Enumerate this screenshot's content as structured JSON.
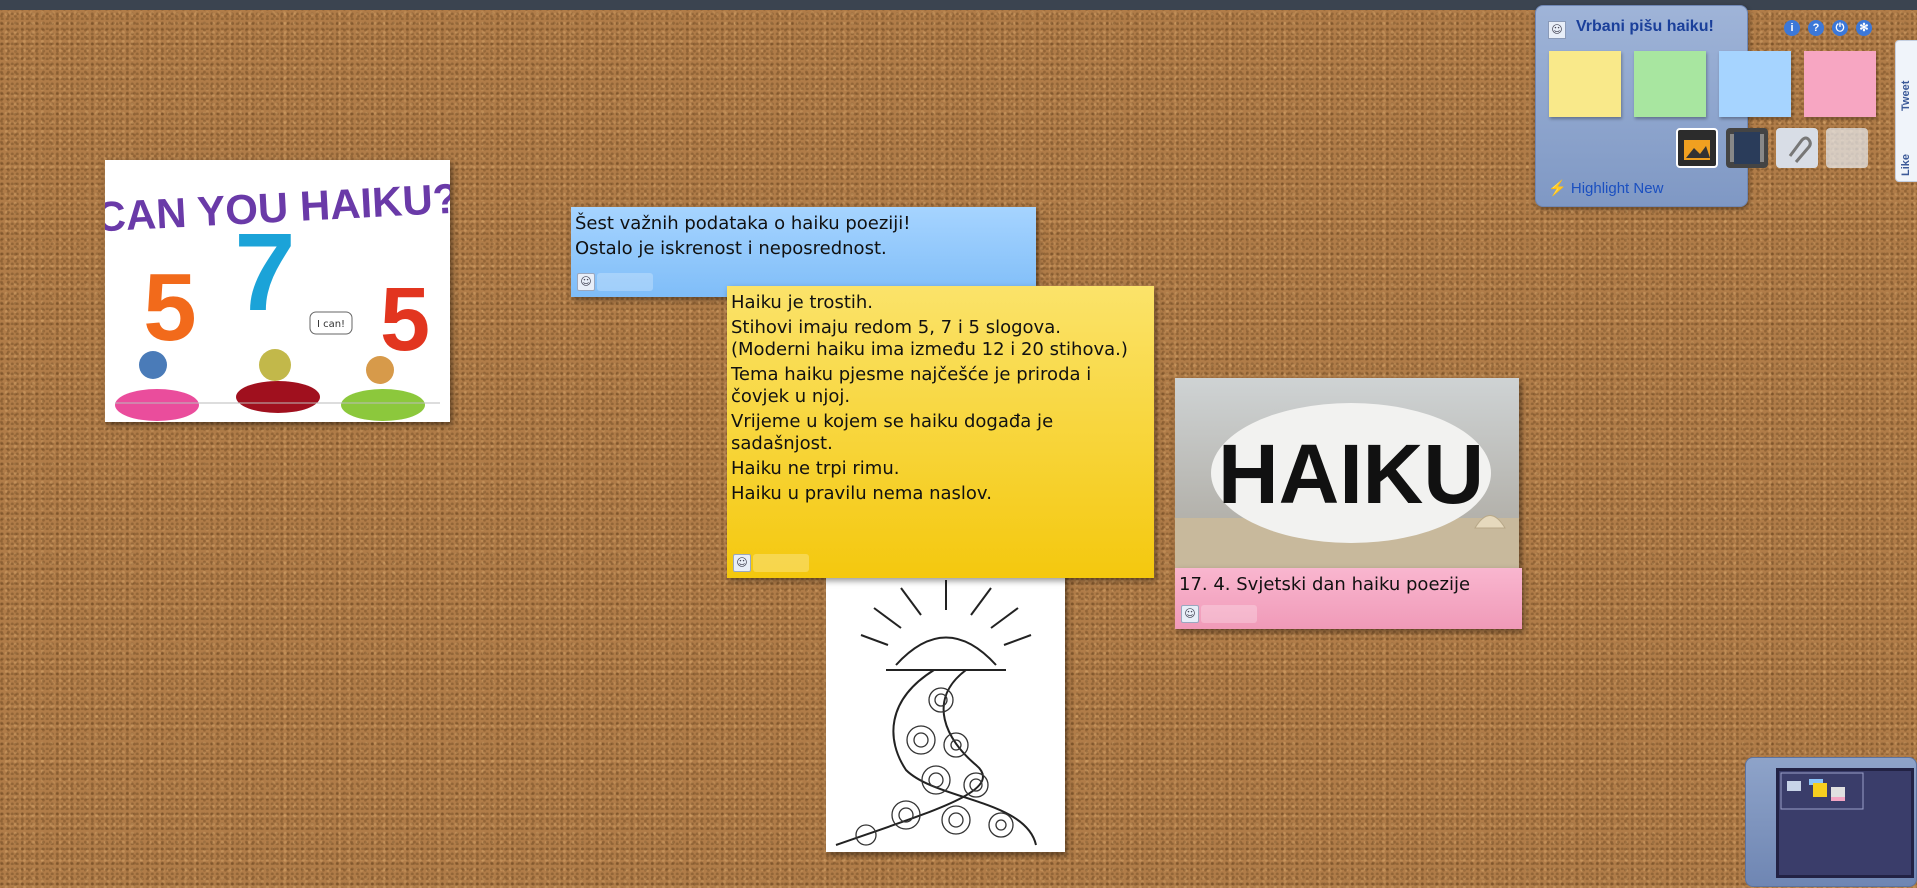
{
  "board": {
    "title": "Vrbani pišu haiku!",
    "highlight_label": "Highlight New",
    "panel_icons": [
      "info-icon",
      "help-icon",
      "power-icon",
      "settings-icon"
    ],
    "pad_colors": [
      "#f9e98a",
      "#a8e6a0",
      "#a6d4ff",
      "#f7a6c2"
    ],
    "media_icons": [
      "image-icon",
      "video-icon",
      "attachment-icon",
      "blank-note-icon"
    ],
    "share": {
      "tweet_label": "Tweet",
      "like_label": "Like"
    }
  },
  "notes": {
    "blue": {
      "lines": [
        "Šest važnih podataka o haiku poeziji!",
        "Ostalo je iskrenost i neposrednost."
      ],
      "color": "#8cc6fb"
    },
    "yellow": {
      "lines": [
        "Haiku je trostih.",
        "Stihovi imaju redom 5, 7 i 5 slogova.",
        "(Moderni haiku ima između 12 i 20 stihova.)",
        "Tema haiku pjesme najčešće je priroda i čovjek u njoj.",
        "Vrijeme u kojem se haiku događa je sadašnjost.",
        "Haiku ne trpi rimu.",
        "Haiku u pravilu nema naslov."
      ],
      "color": "#f6cf1e"
    },
    "pink": {
      "lines": [
        "17. 4. Svjetski dan haiku poezije"
      ],
      "color": "#f3a5c3"
    }
  },
  "images": {
    "can_you_haiku": {
      "title": "CAN YOU HAIKU?",
      "numbers": [
        "5",
        "7",
        "5"
      ],
      "bubble": "I can!"
    },
    "haiku_stone": {
      "text": "HAIKU"
    }
  }
}
